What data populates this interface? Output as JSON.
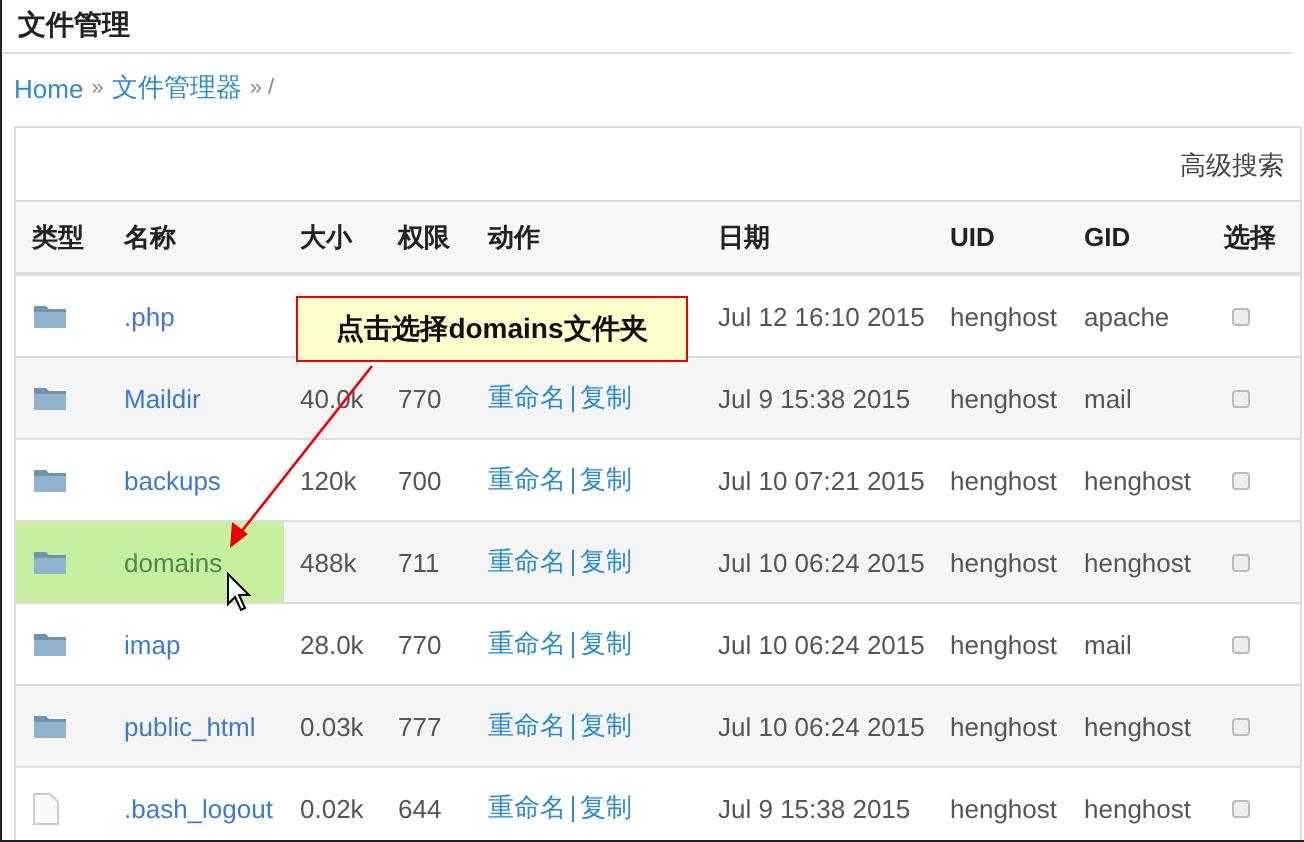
{
  "title": "文件管理",
  "breadcrumb": [
    {
      "label": "Home",
      "link": true
    },
    {
      "label": "»",
      "link": false
    },
    {
      "label": "文件管理器",
      "link": true
    },
    {
      "label": "» /",
      "link": false
    }
  ],
  "advanced_search": "高级搜索",
  "columns": [
    "类型",
    "名称",
    "大小",
    "权限",
    "动作",
    "日期",
    "UID",
    "GID",
    "选择"
  ],
  "rows": [
    {
      "kind": "folder",
      "name": ".php",
      "date": "Jul 12 16:10 2015",
      "uid": "henghost",
      "gid": "apache",
      "highlighted": false,
      "checked": false
    },
    {
      "kind": "folder",
      "name": "Maildir",
      "size": "40.0k",
      "perm": "770",
      "actions": [
        "重命名",
        "复制"
      ],
      "date": "Jul 9 15:38 2015",
      "uid": "henghost",
      "gid": "mail",
      "highlighted": false,
      "checked": false
    },
    {
      "kind": "folder",
      "name": "backups",
      "size": "120k",
      "perm": "700",
      "actions": [
        "重命名",
        "复制"
      ],
      "date": "Jul 10 07:21 2015",
      "uid": "henghost",
      "gid": "henghost",
      "highlighted": false,
      "checked": false
    },
    {
      "kind": "folder",
      "name": "domains",
      "size": "488k",
      "perm": "711",
      "actions": [
        "重命名",
        "复制"
      ],
      "date": "Jul 10 06:24 2015",
      "uid": "henghost",
      "gid": "henghost",
      "highlighted": true,
      "checked": false
    },
    {
      "kind": "folder",
      "name": "imap",
      "size": "28.0k",
      "perm": "770",
      "actions": [
        "重命名",
        "复制"
      ],
      "date": "Jul 10 06:24 2015",
      "uid": "henghost",
      "gid": "mail",
      "highlighted": false,
      "checked": false
    },
    {
      "kind": "folder",
      "name": "public_html",
      "size": "0.03k",
      "perm": "777",
      "actions": [
        "重命名",
        "复制"
      ],
      "date": "Jul 10 06:24 2015",
      "uid": "henghost",
      "gid": "henghost",
      "highlighted": false,
      "checked": false
    },
    {
      "kind": "file",
      "name": ".bash_logout",
      "size": "0.02k",
      "perm": "644",
      "actions": [
        "重命名",
        "复制"
      ],
      "date": "Jul 9 15:38 2015",
      "uid": "henghost",
      "gid": "henghost",
      "highlighted": false,
      "checked": false
    }
  ],
  "callout": "点击选择domains文件夹"
}
